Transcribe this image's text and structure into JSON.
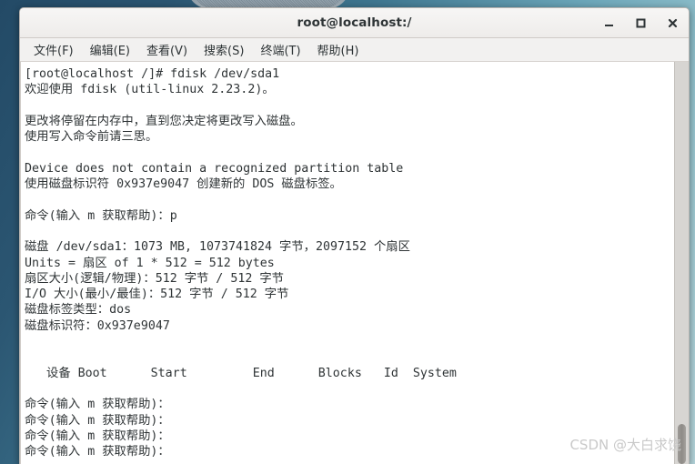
{
  "window": {
    "title": "root@localhost:/",
    "buttons": {
      "minimize": "_",
      "maximize": "□",
      "close": "✕"
    }
  },
  "menubar": {
    "items": [
      {
        "label": "文件(F)"
      },
      {
        "label": "编辑(E)"
      },
      {
        "label": "查看(V)"
      },
      {
        "label": "搜索(S)"
      },
      {
        "label": "终端(T)"
      },
      {
        "label": "帮助(H)"
      }
    ]
  },
  "terminal": {
    "lines": [
      "[root@localhost /]# fdisk /dev/sda1",
      "欢迎使用 fdisk (util-linux 2.23.2)。",
      "",
      "更改将停留在内存中，直到您决定将更改写入磁盘。",
      "使用写入命令前请三思。",
      "",
      "Device does not contain a recognized partition table",
      "使用磁盘标识符 0x937e9047 创建新的 DOS 磁盘标签。",
      "",
      "命令(输入 m 获取帮助)：p",
      "",
      "磁盘 /dev/sda1：1073 MB, 1073741824 字节，2097152 个扇区",
      "Units = 扇区 of 1 * 512 = 512 bytes",
      "扇区大小(逻辑/物理)：512 字节 / 512 字节",
      "I/O 大小(最小/最佳)：512 字节 / 512 字节",
      "磁盘标签类型：dos",
      "磁盘标识符：0x937e9047",
      "",
      "",
      "   设备 Boot      Start         End      Blocks   Id  System",
      "",
      "命令(输入 m 获取帮助)：",
      "命令(输入 m 获取帮助)：",
      "命令(输入 m 获取帮助)：",
      "命令(输入 m 获取帮助)："
    ],
    "partition_table": {
      "headers": [
        "设备",
        "Boot",
        "Start",
        "End",
        "Blocks",
        "Id",
        "System"
      ],
      "rows": []
    },
    "disk_info": {
      "device": "/dev/sda1",
      "size_mb": "1073 MB",
      "size_bytes": "1073741824 字节",
      "sectors": "2097152 个扇区",
      "units": "扇区 of 1 * 512 = 512 bytes",
      "sector_size_logical": "512 字节",
      "sector_size_physical": "512 字节",
      "io_size_min": "512 字节",
      "io_size_optimal": "512 字节",
      "disklabel_type": "dos",
      "disk_identifier": "0x937e9047"
    },
    "colors": {
      "background": "#ffffff",
      "foreground": "#2f3436"
    }
  },
  "watermark": {
    "text": "CSDN @大白求饶"
  }
}
